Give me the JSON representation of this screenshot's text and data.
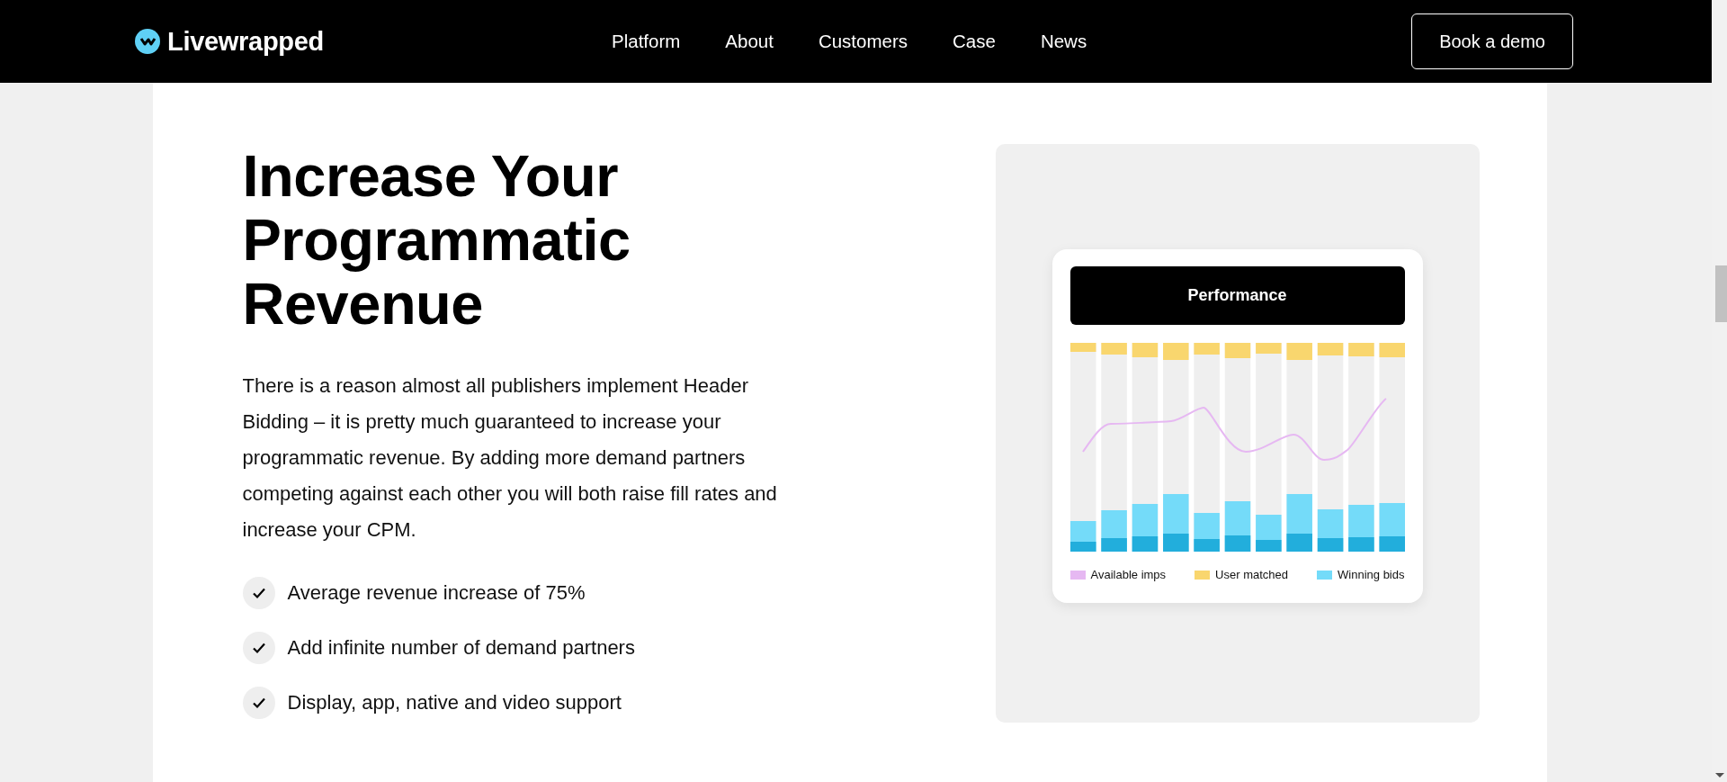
{
  "header": {
    "logo": "Livewrapped",
    "nav": [
      "Platform",
      "About",
      "Customers",
      "Case",
      "News"
    ],
    "cta": "Book a demo"
  },
  "hero": {
    "title": "Increase Your Programmatic Revenue",
    "body": "There is a reason almost all publishers implement Header Bidding – it is pretty much guaranteed to increase your programmatic revenue. By adding more demand partners competing against each other you will both raise fill rates and increase your CPM.",
    "checklist": [
      "Average revenue increase of 75%",
      "Add infinite number of demand partners",
      "Display, app, native and video support"
    ]
  },
  "performance_card": {
    "title": "Performance",
    "legend": [
      {
        "label": "Available imps",
        "color": "#e6b8f2"
      },
      {
        "label": "User matched",
        "color": "#f9d66e"
      },
      {
        "label": "Winning bids",
        "color": "#74dbf9"
      }
    ]
  }
}
